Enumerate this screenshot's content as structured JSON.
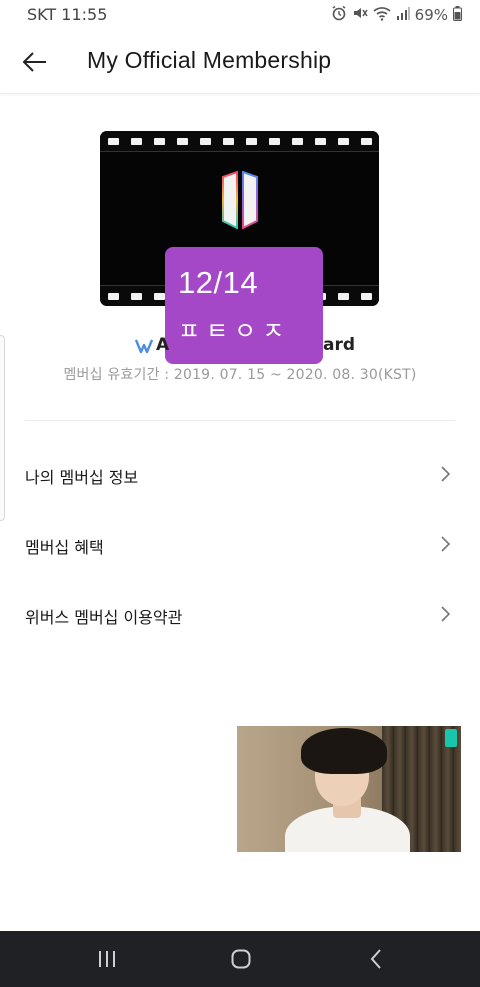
{
  "status_bar": {
    "time": "SKT 11:55",
    "battery": "69%"
  },
  "header": {
    "title": "My Official Membership"
  },
  "membership_card": {
    "name_start": "A",
    "name_end": "ard",
    "validity": "멤버십 유효기간 : 2019. 07. 15 ~ 2020. 08. 30(KST)"
  },
  "overlay": {
    "counter": "12/14",
    "caption": "ㅍㅌㅇㅈ"
  },
  "menu": {
    "items": [
      {
        "label": "나의 멤버십 정보"
      },
      {
        "label": "멤버십 혜택"
      },
      {
        "label": "위버스 멤버십 이용약관"
      }
    ]
  },
  "colors": {
    "overlay_purple": "#a548c7",
    "nav_bar": "#202124",
    "accent_blue": "#4a90e2"
  },
  "icons": {
    "back": "arrow-left-icon",
    "chevron": "chevron-right-icon",
    "weverse": "weverse-icon"
  }
}
